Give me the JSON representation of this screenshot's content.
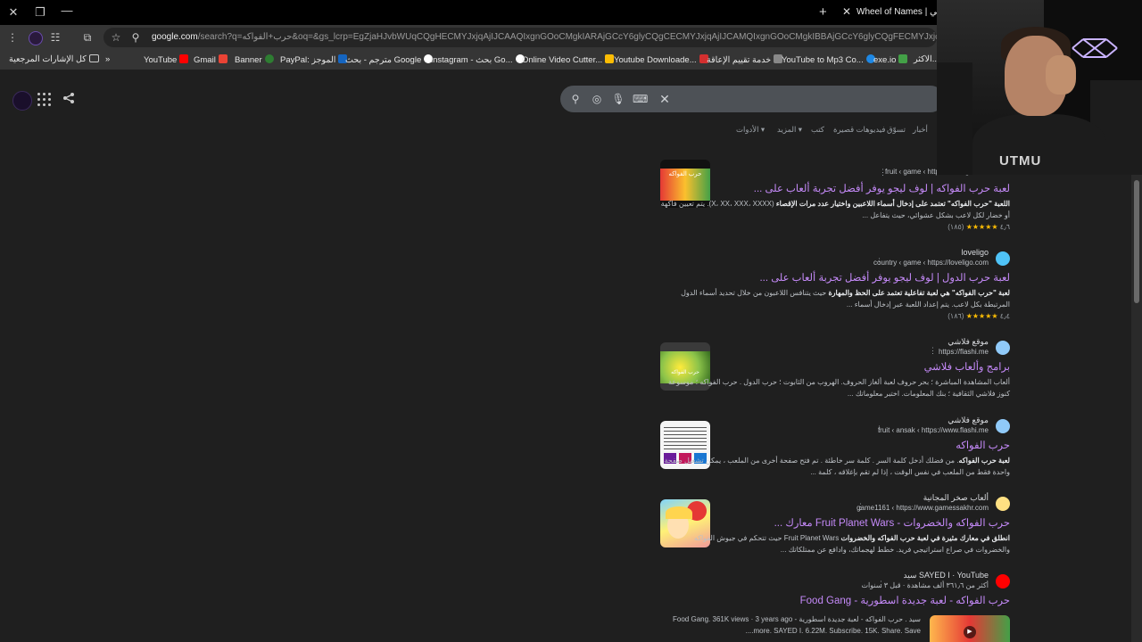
{
  "window": {
    "close_glyph": "✕",
    "restore_glyph": "❐",
    "minimize_glyph": "—",
    "tab_title": "Wheel of Names | عشوائي",
    "tab_close_glyph": "✕",
    "newtab_glyph": "+"
  },
  "address_bar": {
    "url_host": "google.com",
    "url_rest": "/search?q=حرب+الفواكه&oq=&gs_lcrp=EgZjaHJvbWUqCQgHECMYJxjqAjIJCAAQIxgnGOoCMgkIARAjGCcY6glyCQgCECMYJxjqAjIJCAMQIxgnGOoCMgkIBBAjGCcY6glyCQgFECMYJxjqAjIJCAYQLhgnGMcBG"
  },
  "bookmarks": {
    "all_bookmarks": "كل الإشارات المرجعية",
    "more": "»",
    "items": [
      "YouTube",
      "Gmail",
      "Banner",
      "PayPal: الموجز",
      "مترجم - بحث Google",
      "instagram - بحث Go...",
      "Online Video Cutter...",
      "Youtube Downloade...",
      "خدمة تقييم الإعاقة",
      "YouTube to Mp3 Co...",
      "exe.io",
      "الاكثر..."
    ]
  },
  "search": {
    "clear_glyph": "✕"
  },
  "filters": {
    "items": [
      "أخبار",
      "تسوّق",
      "فيديوهات قصيرة",
      "كتب",
      "المزيد ▾",
      "الأدوات ▾"
    ]
  },
  "results": [
    {
      "site_name": "",
      "site_url": "fruit ‹ game ‹ https://loveligo.com",
      "title": "لعبة حرب الفواكه | لوف ليجو يوفر أفضل تجربة ألعاب على ...",
      "snippet_bold": "اللعبة \"حرب الفواكه\" تعتمد على إدخال أسماء اللاعبين واختيار عدد مرات الإقصاء",
      "snippet": " (X، XX، XXX، XXXX). يتم تعيين فاكهة أو خضار لكل لاعب بشكل عشوائي، حيث يتفاعل ...",
      "rating_value": "٤٫٦",
      "rating_stars": "★★★★★",
      "rating_count": "(١٨٥)",
      "thumb_label": "حرب الفواكه"
    },
    {
      "site_name": "loveligo",
      "site_url": "country ‹ game ‹ https://loveligo.com",
      "title": "لعبة حرب الدول | لوف ليجو يوفر أفضل تجربة ألعاب على ...",
      "snippet_bold": "لعبة \"حرب الفواكه\" هي لعبة تفاعلية تعتمد على الحظ والمهارة",
      "snippet": " حيث يتنافس اللاعبون من خلال تحديد أسماء الدول المرتبطة بكل لاعب. يتم إعداد اللعبة عبر إدخال أسماء ...",
      "rating_value": "٤٫٤",
      "rating_stars": "★★★★★",
      "rating_count": "(١٨٦)",
      "thumb_label": ""
    },
    {
      "site_name": "موقع فلاشي",
      "site_url": "https://flashi.me",
      "title": "برامج وألعاب فلاشي",
      "snippet_bold": "حرب الفواكه",
      "snippet": "ألعاب المشاهدة المباشرة ؛ بحر حروف لعبة ألغاز الحروف. الهروب من الثابوت ؛ حرب الدول . حرب الفواكه ؛ موسوعة كنوز فلاشي الثقافية ؛ بنك المعلومات. اختبر معلوماتك ...",
      "rating_value": "",
      "rating_stars": "",
      "rating_count": "",
      "thumb_label": "حرب الفواكه"
    },
    {
      "site_name": "موقع فلاشي",
      "site_url": "fruit ‹ ansak ‹ https://www.flashi.me",
      "title": "حرب الفواكه",
      "snippet_bold": "لعبة حرب الفواكه",
      "snippet": ". من فضلك أدخل كلمة السر . كلمة سر خاطئة . تم فتح صفحة أخرى من الملعب ، يمكن تشغيل صفحة واحدة فقط من الملعب في نفس الوقت ، إذا لم تقم بإغلاقه ، كلمة ...",
      "rating_value": "",
      "rating_stars": "",
      "rating_count": "",
      "thumb_label": ""
    },
    {
      "site_name": "ألعاب صخر المجانية",
      "site_url": "game1161 ‹ https://www.gamessakhr.com",
      "title": "حرب الفواكه والخضروات - Fruit Planet Wars معارك ...",
      "snippet_bold": "انطلق في معارك مثيرة في لعبة حرب الفواكه والخضروات",
      "snippet": " Fruit Planet Wars حيث تتحكم في جيوش الفواكه والخضروات في صراع استراتيجي فريد. خطط لهجماتك، وادافع عن ممتلكاتك ...",
      "rating_value": "",
      "rating_stars": "",
      "rating_count": "",
      "thumb_label": ""
    },
    {
      "site_name": "SAYED I · YouTube سيد",
      "site_url": "أكثر من ٣٦١٫٦ ألف مشاهدة · قبل ٣ سنوات",
      "title": "حرب الفواكه - لعبة جديدة اسطورية - Food Gang",
      "snippet_bold": "حرب الفواكه",
      "snippet": "سيد . حرب الفواكه - لعبة جديدة اسطورية - Food Gang. 361K views · 3 years ago ...more. SAYED I. 6.22M. Subscribe. 15K. Share. Save.",
      "rating_value": "",
      "rating_stars": "",
      "rating_count": "",
      "thumb_label": ""
    }
  ],
  "webcam": {
    "shirt_text": "UTMU"
  },
  "colors": {
    "result_title": "#c58af9",
    "background": "#1f1f1f",
    "star": "#fbbc04"
  }
}
